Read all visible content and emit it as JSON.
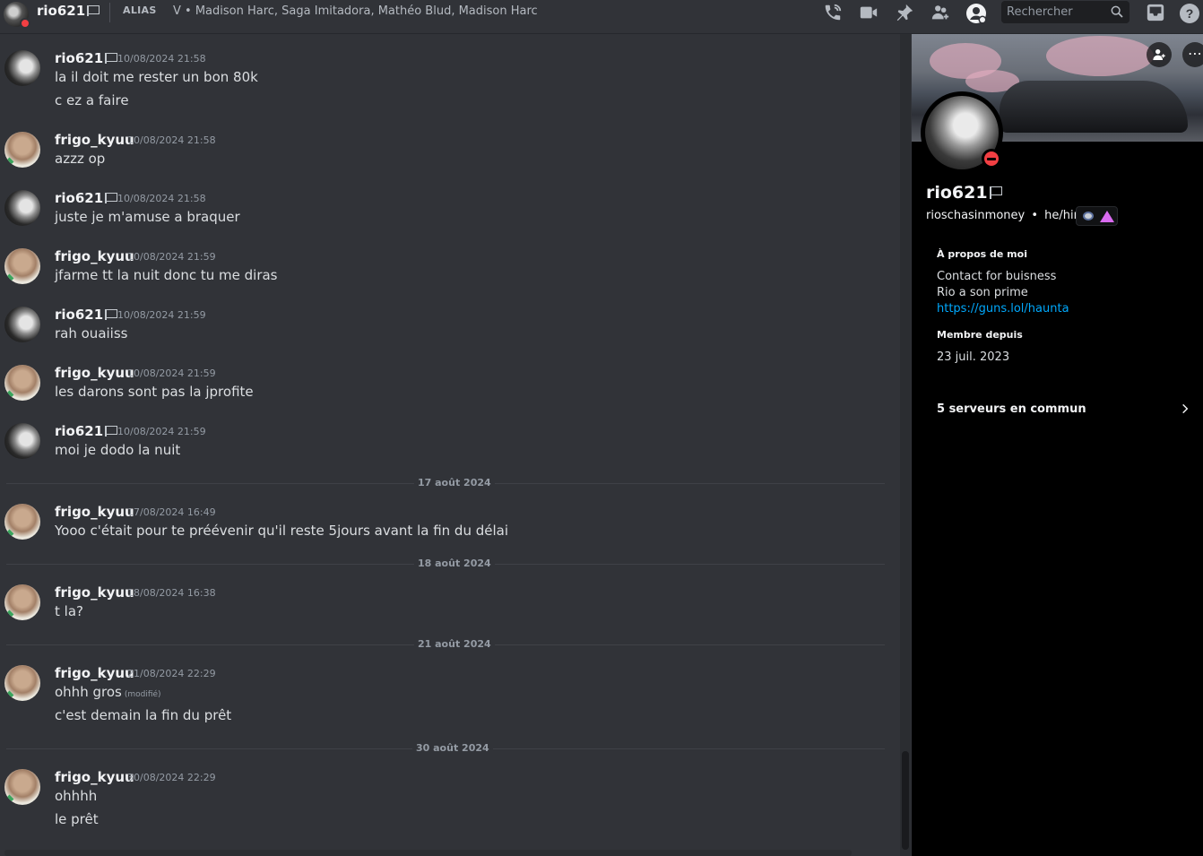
{
  "header": {
    "username": "rio621",
    "alias_tag": "ALIAS",
    "alias_names": "V • Madison Harc, Saga Imitadora, Mathéo Blud, Madison Harc",
    "search_placeholder": "Rechercher",
    "icons": [
      "phone-call-icon",
      "video-call-icon",
      "pin-icon",
      "add-friends-icon",
      "user-profile-icon",
      "search-icon",
      "inbox-icon",
      "help-icon"
    ]
  },
  "messages": [
    {
      "author": "rio621",
      "timestamp": "10/08/2024 21:58",
      "lines": [
        "la il doit me rester un bon 80k",
        "c ez a faire"
      ]
    },
    {
      "author": "frigo_kyuu",
      "timestamp": "10/08/2024 21:58",
      "lines": [
        "azzz op"
      ]
    },
    {
      "author": "rio621",
      "timestamp": "10/08/2024 21:58",
      "lines": [
        "juste je m'amuse a braquer"
      ]
    },
    {
      "author": "frigo_kyuu",
      "timestamp": "10/08/2024 21:59",
      "lines": [
        "jfarme tt la nuit donc tu me diras"
      ]
    },
    {
      "author": "rio621",
      "timestamp": "10/08/2024 21:59",
      "lines": [
        "rah ouaiiss"
      ]
    },
    {
      "author": "frigo_kyuu",
      "timestamp": "10/08/2024 21:59",
      "lines": [
        "les darons sont pas la jprofite"
      ]
    },
    {
      "author": "rio621",
      "timestamp": "10/08/2024 21:59",
      "lines": [
        "moi je dodo la nuit"
      ]
    },
    {
      "author": "frigo_kyuu",
      "timestamp": "17/08/2024 16:49",
      "lines": [
        "Yooo c'était pour te préévenir qu'il reste 5jours avant la fin du délai"
      ]
    },
    {
      "author": "frigo_kyuu",
      "timestamp": "18/08/2024 16:38",
      "lines": [
        "t la?"
      ]
    },
    {
      "author": "frigo_kyuu",
      "timestamp": "21/08/2024 22:29",
      "lines": [
        "ohhh gros",
        "c'est demain la fin du prêt"
      ],
      "edited_label": "(modifié)"
    },
    {
      "author": "frigo_kyuu",
      "timestamp": "30/08/2024 22:29",
      "lines": [
        "ohhhh",
        "le prêt"
      ]
    }
  ],
  "dividers": [
    "17 août 2024",
    "18 août 2024",
    "21 août 2024",
    "30 août 2024"
  ],
  "profile": {
    "display_name": "rio621",
    "username": "rioschasinmoney",
    "pronouns": "he/him",
    "about_title": "À propos de moi",
    "about_lines": [
      "Contact for buisness",
      "Rio a son prime"
    ],
    "about_link": "https://guns.lol/haunta",
    "member_since_title": "Membre depuis",
    "member_since": "23 juil. 2023",
    "mutual_servers": "5 serveurs en commun",
    "more_label": "⋯"
  }
}
